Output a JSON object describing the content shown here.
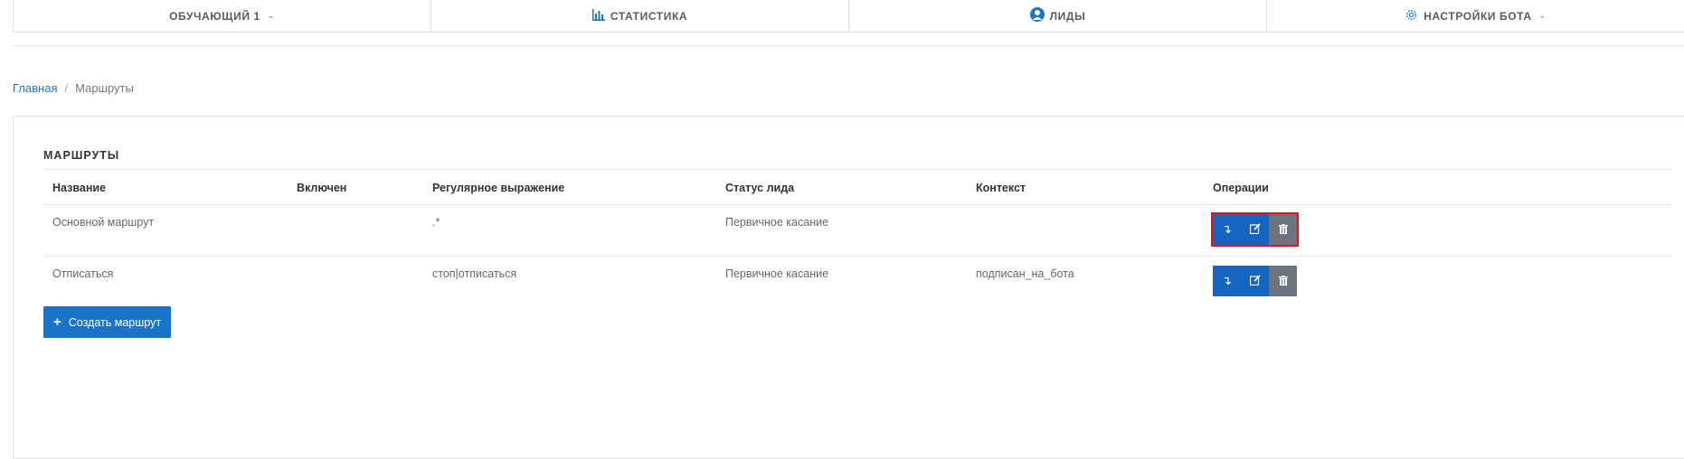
{
  "nav": {
    "items": [
      {
        "label": "ОБУЧАЮЩИЙ 1",
        "icon": "",
        "chevron": "⌄"
      },
      {
        "label": "СТАТИСТИКА",
        "icon": "bar-chart-icon"
      },
      {
        "label": "ЛИДЫ",
        "icon": "user-circle-icon"
      },
      {
        "label": "НАСТРОЙКИ БОТА",
        "icon": "gear-icon",
        "chevron": "⌄"
      }
    ],
    "accent": "#1e73be"
  },
  "breadcrumb": {
    "home": "Главная",
    "separator": "/",
    "current": "Маршруты"
  },
  "card": {
    "title": "МАРШРУТЫ"
  },
  "table": {
    "headers": [
      "Название",
      "Включен",
      "Регулярное выражение",
      "Статус лида",
      "Контекст",
      "Операции"
    ],
    "rows": [
      {
        "name": "Основной маршрут",
        "enabled": "",
        "regex": ".*",
        "status": "Первичное касание",
        "context": ""
      },
      {
        "name": "Отписаться",
        "enabled": "",
        "regex": "стоп|отписаться",
        "status": "Первичное касание",
        "context": "подписан_на_бота"
      }
    ]
  },
  "actions": {
    "create_label": "Создать маршрут",
    "create_icon": "+"
  },
  "colors": {
    "primary_button": "#1565c0",
    "delete_button": "#6c757d",
    "highlight": "#e0141e"
  }
}
